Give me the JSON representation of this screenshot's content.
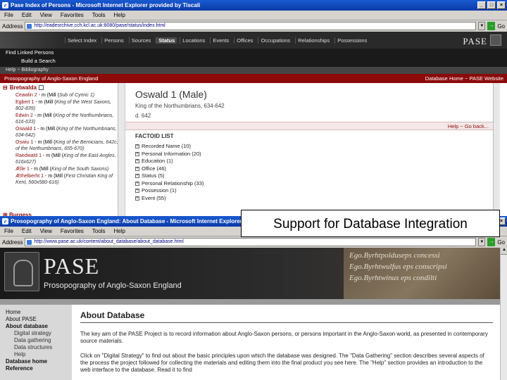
{
  "window1": {
    "title": "Pase Index of Persons - Microsoft Internet Explorer provided by Tiscali",
    "menu": [
      "File",
      "Edit",
      "View",
      "Favorites",
      "Tools",
      "Help"
    ],
    "address_label": "Address",
    "address_value": "http://eadesrchive.cch.kcl.ac.uk:8080/pase/status/index.html",
    "go_label": "Go",
    "nav_tabs": [
      "Select Index",
      "Persons",
      "Sources",
      "Status",
      "Locations",
      "Events",
      "Offices",
      "Occupations",
      "Relationships",
      "Possessions"
    ],
    "active_tab": "Status",
    "logo_text": "PASE",
    "find_linked": "Find Linked Persons",
    "build_search": "Build a Search",
    "help_strip": "Help ~ Bibliography",
    "site_title": "Prosopography of Anglo-Saxon England",
    "right_links": "Database Home ~ PASE Website",
    "left_heading": "Bretwalda",
    "left_items": [
      {
        "name": "Ceawlin 2",
        "rest": " - m (Mill (",
        "it": "Sub of Cynric 1)"
      },
      {
        "name": "Egbert 1",
        "rest": " - m (Mill (",
        "it": "King of the West Saxons, 802-839)"
      },
      {
        "name": "Edwin 2",
        "rest": " - m (Mill (",
        "it": "King of the Northumbrians, 616-633)"
      },
      {
        "name": "Oswald 1",
        "rest": " - m (Mill (",
        "it": "King of the Northumbrians, 634-642)"
      },
      {
        "name": "Oswiu 1",
        "rest": " - m (Mill (",
        "it": "King of the Bernicians, 642c; of the Northumbrians, 655-670)"
      },
      {
        "name": "Raedwald 1",
        "rest": " - m (Mill (",
        "it": "King of the East Angles, d. 616x627)"
      },
      {
        "name": "Ælle 1",
        "rest": " - m (Mill (",
        "it": "King of the South Saxons)"
      },
      {
        "name": "Æthelberht 1",
        "rest": " - m (Mill (",
        "it": "First Christian King of Kent, 560x580-616)"
      }
    ],
    "left_footer": "Burgess",
    "person_name": "Oswald 1 (Male)",
    "person_title": "King of the Northumbrians, 634-642",
    "person_date": "d. 642",
    "action_links": "Help ~ Go back...",
    "factoid_heading": "FACTOID LIST",
    "factoids": [
      "Recorded Name (10)",
      "Personal Information (20)",
      "Education (1)",
      "Office (46)",
      "Status (5)",
      "Personal Relationship (33)",
      "Possession (1)",
      "Event (55)"
    ]
  },
  "callout": "Support for Database Integration",
  "window2": {
    "title": "Prosopography of Anglo-Saxon England: About Database - Microsoft Internet Explorer provided by Tiscali",
    "menu": [
      "File",
      "Edit",
      "View",
      "Favorites",
      "Tools",
      "Help"
    ],
    "address_label": "Address",
    "address_value": "http://www.pase.ac.uk/content/about_database/about_database.html",
    "go_label": "Go",
    "banner_title": "PASE",
    "banner_subtitle": "Prosopography of Anglo-Saxon England",
    "manuscript_lines": [
      "Ego.Byrhtpolduseps concessi",
      "Ego.Byrhtwulfus eps conscripsi",
      "Ego.Byrhtwinus eps condilti"
    ],
    "nav": {
      "home": "Home",
      "about_pase": "About PASE",
      "about_database": "About database",
      "sub": [
        "Digital strategy",
        "Data gathering",
        "Data structures",
        "Help"
      ],
      "database_home": "Database home",
      "reference": "Reference"
    },
    "page_title": "About Database",
    "para1": "The key aim of the PASE Project is to record information about Anglo-Saxon persons, or persons important in the Anglo-Saxon world, as presented in contemporary source materials.",
    "para2": "Click on \"Digital Strategy\" to find out about the basic principles upon which the database was designed. The \"Data Gathering\" section describes several aspects of the process the project followed for collecting the materials and editing them into the final product you see here. The \"Help\" section provides an introduction to the web interface to the database. Read it to find"
  },
  "colors": {
    "titlebar": "#0b3aa8",
    "accent_red": "#8b0a0a",
    "chrome": "#d6d3ce"
  }
}
